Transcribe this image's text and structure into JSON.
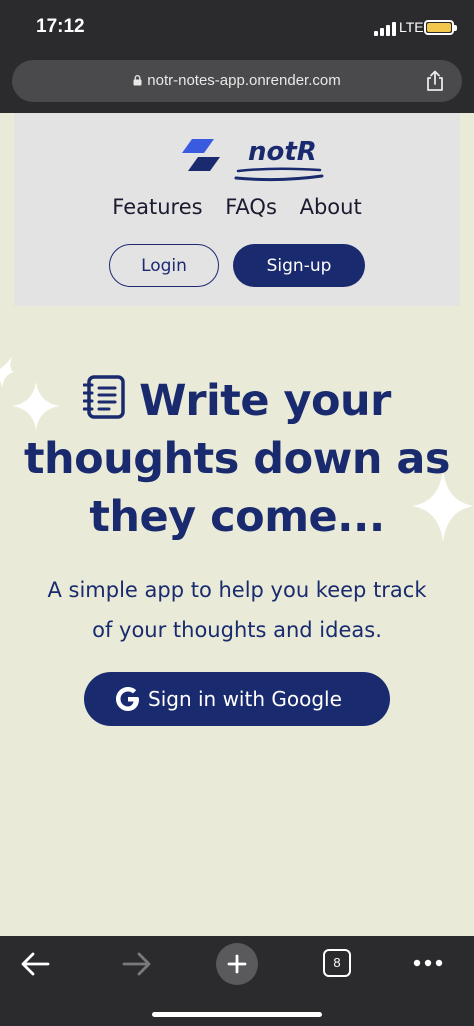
{
  "status_bar": {
    "time": "17:12",
    "network": "LTE"
  },
  "browser": {
    "url": "notr-notes-app.onrender.com",
    "tab_count": "8"
  },
  "header": {
    "brand": "notR",
    "nav": [
      "Features",
      "FAQs",
      "About"
    ],
    "login_label": "Login",
    "signup_label": "Sign-up"
  },
  "hero": {
    "title_line1": "Write your",
    "title_line2": "thoughts down as",
    "title_line3": "they come...",
    "subtitle_line1": "A simple app to help you keep track",
    "subtitle_line2": "of your thoughts and ideas.",
    "google_button": "Sign in with Google"
  },
  "colors": {
    "primary": "#1a2a6e",
    "page_bg": "#e9ebd8",
    "header_bg": "#e3e3e4",
    "chrome": "#2b2b2d"
  }
}
